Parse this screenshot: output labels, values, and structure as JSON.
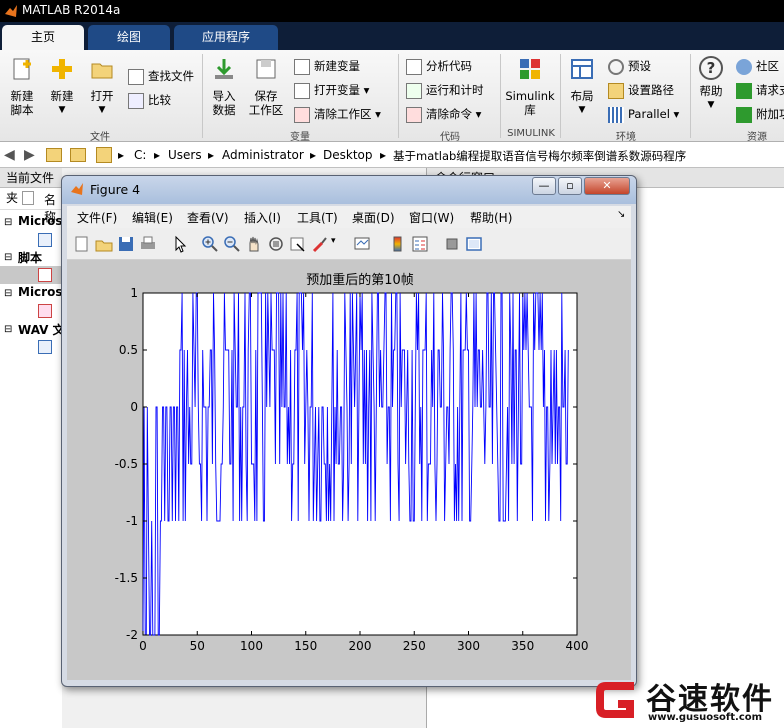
{
  "app": {
    "title": "MATLAB R2014a"
  },
  "tabs": [
    {
      "label": "主页",
      "active": true
    },
    {
      "label": "绘图",
      "active": false
    },
    {
      "label": "应用程序",
      "active": false
    }
  ],
  "ribbon": {
    "file": {
      "new_script": "新建\n脚本",
      "new": "新建",
      "open": "打开",
      "find_files": "查找文件",
      "compare": "比较",
      "group": "文件"
    },
    "variable": {
      "import": "导入\n数据",
      "save_ws": "保存\n工作区",
      "new_var": "新建变量",
      "open_var": "打开变量",
      "clear_ws": "清除工作区",
      "group": "变量"
    },
    "code": {
      "analyze": "分析代码",
      "run_time": "运行和计时",
      "clear_cmd": "清除命令",
      "group": "代码"
    },
    "simulink": {
      "label": "Simulink\n库",
      "group": "SIMULINK"
    },
    "env": {
      "layout": "布局",
      "prefs": "预设",
      "set_path": "设置路径",
      "parallel": "Parallel",
      "group": "环境"
    },
    "resources": {
      "help": "帮助",
      "community": "社区",
      "request": "请求支",
      "addons": "附加功",
      "group": "资源"
    }
  },
  "address": {
    "crumbs": [
      "C:",
      "Users",
      "Administrator",
      "Desktop",
      "基于matlab编程提取语音信号梅尔频率倒谱系数源码程序"
    ]
  },
  "left_panel": {
    "header": "当前文件夹",
    "name_col": "名称",
    "groups": [
      "Microsof",
      "脚本",
      "Microsof",
      "WAV 文"
    ]
  },
  "right_panel": {
    "header": "命令行窗口"
  },
  "figure": {
    "title": "Figure 4",
    "menus": [
      "文件(F)",
      "编辑(E)",
      "查看(V)",
      "插入(I)",
      "工具(T)",
      "桌面(D)",
      "窗口(W)",
      "帮助(H)"
    ]
  },
  "chart_data": {
    "type": "line",
    "title": "预加重后的第10帧",
    "xlim": [
      0,
      400
    ],
    "ylim": [
      -2,
      1
    ],
    "xticks": [
      0,
      50,
      100,
      150,
      200,
      250,
      300,
      350,
      400
    ],
    "yticks": [
      1,
      0.5,
      0,
      -0.5,
      -1,
      -1.5,
      -2
    ],
    "xlabel": "",
    "ylabel": "",
    "grid": false,
    "line_color": "#0000ff",
    "series": [
      {
        "x": [
          0,
          200,
          400
        ],
        "y": [
          -1,
          0,
          1
        ],
        "note_values": "dense oscillation between -2 and 1 across 0-400; values estimated by band",
        "bands": [
          {
            "x_from": 0,
            "x_to": 16,
            "low": -2,
            "high": 0
          },
          {
            "x_from": 16,
            "x_to": 34,
            "low": -1,
            "high": 0
          },
          {
            "x_from": 34,
            "x_to": 370,
            "low": -1,
            "high": 1
          },
          {
            "x_from": 370,
            "x_to": 392,
            "low": -1,
            "high": 1
          }
        ]
      }
    ]
  },
  "watermark": {
    "text_cn": "谷速软件",
    "url": "www.gusuosoft.com"
  },
  "colors": {
    "accent": "#1f4a86",
    "plot_line": "#0000ff",
    "watermark_red": "#d81f26"
  }
}
